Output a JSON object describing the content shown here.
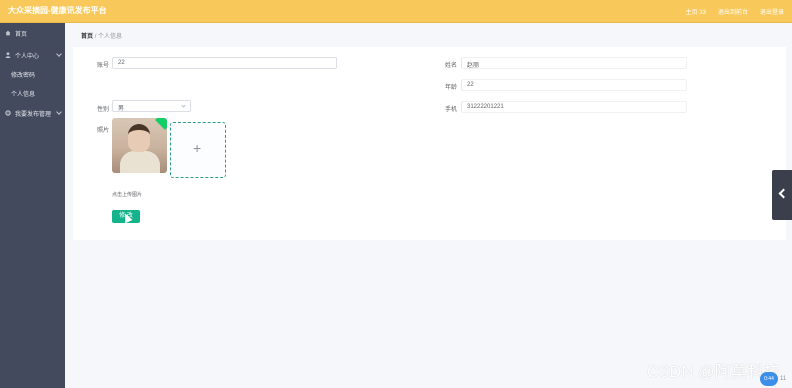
{
  "header": {
    "app_title": "大众采摘园-健康讯发布平台",
    "links": [
      "主页 33",
      "退出到前台",
      "退出登录"
    ]
  },
  "sidebar": {
    "home": "首页",
    "personal_center": "个人中心",
    "personal_center_items": [
      "修改密码",
      "个人信息"
    ],
    "management": "我要发布管理"
  },
  "breadcrumb": {
    "root": "首页",
    "separator": "/",
    "current": "个人信息"
  },
  "form": {
    "account_label": "账号",
    "account_value": "22",
    "name_label": "姓名",
    "name_value": "赵丽",
    "age_label": "年龄",
    "age_value": "22",
    "gender_label": "性别",
    "gender_value": "男",
    "phone_label": "手机",
    "phone_value": "31222201221",
    "photo_label": "照片",
    "upload_plus": "+",
    "tip": "点击上传图片",
    "submit_label": "修 改"
  },
  "watermark": "CSDN @阿莫科技",
  "corner_badge": "0:44",
  "corner_text": "11",
  "colors": {
    "header_bg": "#f8c95a",
    "sidebar_bg": "#434a5d",
    "button": "#13b38b",
    "toggle_bg": "#3a3f4b"
  }
}
